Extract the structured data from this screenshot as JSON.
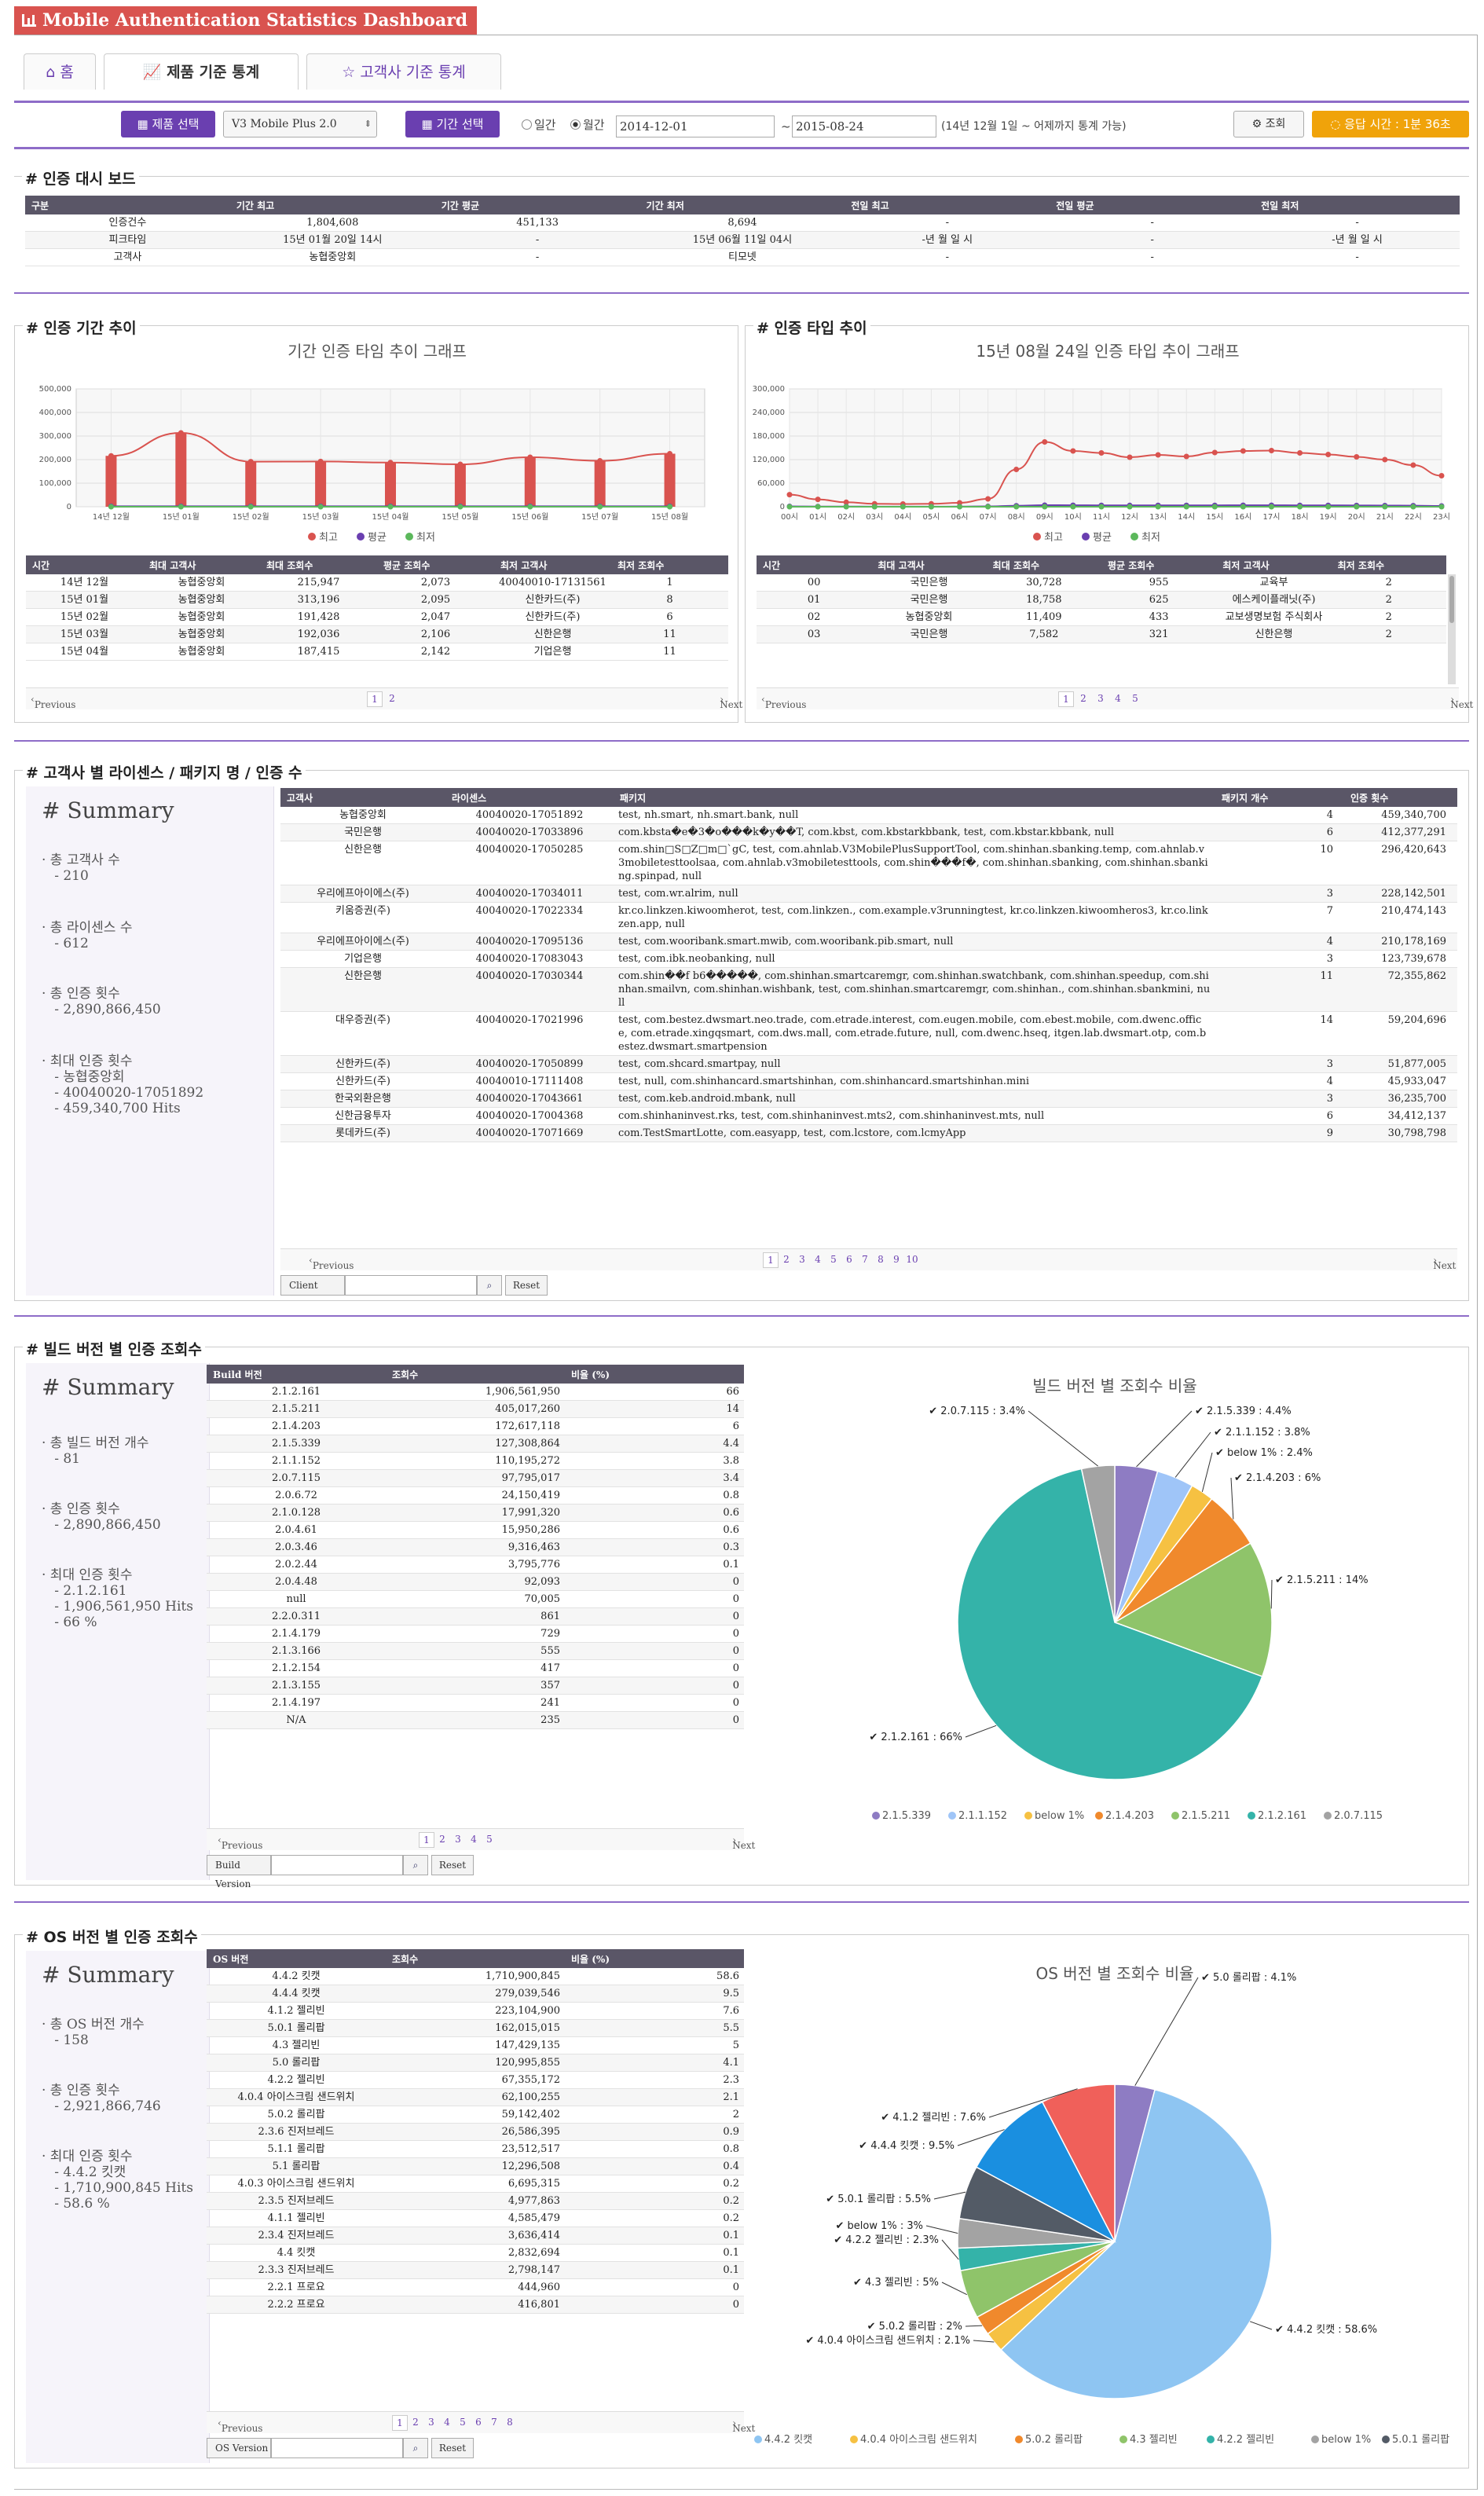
{
  "app": {
    "title": "Mobile Authentication Statistics Dashboard"
  },
  "tabs": [
    {
      "label": "홈",
      "icon": "home-icon"
    },
    {
      "label": "제품 기준 통계",
      "icon": "chart-icon"
    },
    {
      "label": "고객사 기준 통계",
      "icon": "star-icon"
    }
  ],
  "toolbar": {
    "product_btn": "제품 선택",
    "product_value": "V3 Mobile Plus 2.0",
    "period_btn": "기간 선택",
    "radio_daily": "일간",
    "radio_monthly": "월간",
    "selected": "월간",
    "from": "2014-12-01",
    "tilde": "~",
    "to": "2015-08-24",
    "note": "(14년 12월 1일 ~ 어제까지 통계 가능)",
    "query_btn": "조회",
    "response": "응답 시간 : 1분 36초"
  },
  "dashboard": {
    "title": "# 인증 대시 보드",
    "headers": [
      "구분",
      "기간 최고",
      "기간 평균",
      "기간 최저",
      "전일 최고",
      "전일 평균",
      "전일 최저"
    ],
    "rows": [
      [
        "인증건수",
        "1,804,608",
        "451,133",
        "8,694",
        "-",
        "-",
        "-"
      ],
      [
        "피크타임",
        "15년 01월 20일 14시",
        "-",
        "15년 06월 11일 04시",
        "-년 월 일 시",
        "-",
        "-년 월 일 시"
      ],
      [
        "고객사",
        "농협중앙회",
        "-",
        "티모넷",
        "-",
        "-",
        "-"
      ]
    ]
  },
  "period_trend": {
    "title": "# 인증 기간 추이",
    "chart_title": "기간 인증 타임 추이 그래프",
    "headers": [
      "시간",
      "최대 고객사",
      "최대 조회수",
      "평균 조회수",
      "최저 고객사",
      "최저 조회수"
    ],
    "rows": [
      [
        "14년 12월",
        "농협중앙회",
        "215,947",
        "2,073",
        "40040010-17131561",
        "1"
      ],
      [
        "15년 01월",
        "농협중앙회",
        "313,196",
        "2,095",
        "신한카드(주)",
        "8"
      ],
      [
        "15년 02월",
        "농협중앙회",
        "191,428",
        "2,047",
        "신한카드(주)",
        "6"
      ],
      [
        "15년 03월",
        "농협중앙회",
        "192,036",
        "2,106",
        "신한은행",
        "11"
      ],
      [
        "15년 04월",
        "농협중앙회",
        "187,415",
        "2,142",
        "기업은행",
        "11"
      ]
    ],
    "pager": {
      "prev": "Previous",
      "next": "Next",
      "pages": [
        "1",
        "2"
      ]
    }
  },
  "type_trend": {
    "title": "# 인증 타입 추이",
    "chart_title": "15년 08월 24일 인증 타입 추이 그래프",
    "headers": [
      "시간",
      "최대 고객사",
      "최대 조회수",
      "평균 조회수",
      "최저 고객사",
      "최저 조회수"
    ],
    "rows": [
      [
        "00",
        "국민은행",
        "30,728",
        "955",
        "교육부",
        "2"
      ],
      [
        "01",
        "국민은행",
        "18,758",
        "625",
        "에스케이플래닛(주)",
        "2"
      ],
      [
        "02",
        "농협중앙회",
        "11,409",
        "433",
        "교보생명보험 주식회사",
        "2"
      ],
      [
        "03",
        "국민은행",
        "7,582",
        "321",
        "신한은행",
        "2"
      ]
    ],
    "pager": {
      "prev": "Previous",
      "next": "Next",
      "pages": [
        "1",
        "2",
        "3",
        "4",
        "5"
      ]
    }
  },
  "client_section": {
    "title": "# 고객사 별 라이센스 / 패키지 명 / 인증 수",
    "summary": {
      "heading": "# Summary",
      "items": [
        "· 총 고객사 수\n   - 210",
        "· 총 라이센스 수\n   - 612",
        "· 총 인증 횟수\n   - 2,890,866,450",
        "· 최대 인증 횟수\n   - 농협중앙회\n   - 40040020-17051892\n   - 459,340,700 Hits"
      ]
    },
    "headers": [
      "고객사",
      "라이센스",
      "패키지",
      "패키지 개수",
      "인증 횟수"
    ],
    "rows": [
      [
        "농협중앙회",
        "40040020-17051892",
        "test, nh.smart, nh.smart.bank, null",
        "4",
        "459,340,700"
      ],
      [
        "국민은행",
        "40040020-17033896",
        "com.kbsta�e�3�o���k�y��T, com.kbst, com.kbstarkbbank, test, com.kbstar.kbbank, null",
        "6",
        "412,377,291"
      ],
      [
        "신한은행",
        "40040020-17050285",
        "com.shin□S□Z□m□`gC, test, com.ahnlab.V3MobilePlusSupportTool, com.shinhan.sbanking.temp, com.ahnlab.v3mobiletesttoolsaa, com.ahnlab.v3mobiletesttools, com.shin���f�, com.shinhan.sbanking, com.shinhan.sbanking.spinpad, null",
        "10",
        "296,420,643"
      ],
      [
        "우리에프아이에스(주)",
        "40040020-17034011",
        "test, com.wr.alrim, null",
        "3",
        "228,142,501"
      ],
      [
        "키움증권(주)",
        "40040020-17022334",
        "kr.co.linkzen.kiwoomherot, test, com.linkzen., com.example.v3runningtest, kr.co.linkzen.kiwoomheros3, kr.co.linkzen.app, null",
        "7",
        "210,474,143"
      ],
      [
        "우리에프아이에스(주)",
        "40040020-17095136",
        "test, com.wooribank.smart.mwib, com.wooribank.pib.smart, null",
        "4",
        "210,178,169"
      ],
      [
        "기업은행",
        "40040020-17083043",
        "test, com.ibk.neobanking, null",
        "3",
        "123,739,678"
      ],
      [
        "신한은행",
        "40040020-17030344",
        "com.shin��f b6�����, com.shinhan.smartcaremgr, com.shinhan.swatchbank, com.shinhan.speedup, com.shinhan.smailvn, com.shinhan.wishbank, test, com.shinhan.smartcaremgr, com.shinhan., com.shinhan.sbankmini, null",
        "11",
        "72,355,862"
      ],
      [
        "대우증권(주)",
        "40040020-17021996",
        "test, com.bestez.dwsmart.neo.trade, com.etrade.interest, com.eugen.mobile, com.ebest.mobile, com.dwenc.office, com.etrade.xingqsmart, com.dws.mall, com.etrade.future, null, com.dwenc.hseq, itgen.lab.dwsmart.otp, com.bestez.dwsmart.smartpension",
        "14",
        "59,204,696"
      ],
      [
        "신한카드(주)",
        "40040020-17050899",
        "test, com.shcard.smartpay, null",
        "3",
        "51,877,005"
      ],
      [
        "신한카드(주)",
        "40040010-17111408",
        "test, null, com.shinhancard.smartshinhan, com.shinhancard.smartshinhan.mini",
        "4",
        "45,933,047"
      ],
      [
        "한국외환은행",
        "40040020-17043661",
        "test, com.keb.android.mbank, null",
        "3",
        "36,235,700"
      ],
      [
        "신한금융투자",
        "40040020-17004368",
        "com.shinhaninvest.rks, test, com.shinhaninvest.mts2, com.shinhaninvest.mts, null",
        "6",
        "34,412,137"
      ],
      [
        "롯데카드(주)",
        "40040020-17071669",
        "com.TestSmartLotte, com.easyapp, test, com.lcstore, com.lcmyApp",
        "9",
        "30,798,798"
      ]
    ],
    "pager": {
      "prev": "Previous",
      "next": "Next",
      "pages": [
        "1",
        "2",
        "3",
        "4",
        "5",
        "6",
        "7",
        "8",
        "9",
        "10"
      ]
    },
    "search": {
      "label": "Client",
      "reset": "Reset"
    }
  },
  "build_section": {
    "title": "# 빌드 버전 별 인증 조회수",
    "summary": {
      "heading": "# Summary",
      "items": [
        "· 총 빌드 버전 개수\n   - 81",
        "· 총 인증 횟수\n   - 2,890,866,450",
        "· 최대 인증 횟수\n   - 2.1.2.161\n   - 1,906,561,950 Hits\n   - 66 %"
      ]
    },
    "headers": [
      "Build 버전",
      "조회수",
      "비율 (%)"
    ],
    "rows": [
      [
        "2.1.2.161",
        "1,906,561,950",
        "66"
      ],
      [
        "2.1.5.211",
        "405,017,260",
        "14"
      ],
      [
        "2.1.4.203",
        "172,617,118",
        "6"
      ],
      [
        "2.1.5.339",
        "127,308,864",
        "4.4"
      ],
      [
        "2.1.1.152",
        "110,195,272",
        "3.8"
      ],
      [
        "2.0.7.115",
        "97,795,017",
        "3.4"
      ],
      [
        "2.0.6.72",
        "24,150,419",
        "0.8"
      ],
      [
        "2.1.0.128",
        "17,991,320",
        "0.6"
      ],
      [
        "2.0.4.61",
        "15,950,286",
        "0.6"
      ],
      [
        "2.0.3.46",
        "9,316,463",
        "0.3"
      ],
      [
        "2.0.2.44",
        "3,795,776",
        "0.1"
      ],
      [
        "2.0.4.48",
        "92,093",
        "0"
      ],
      [
        "null",
        "70,005",
        "0"
      ],
      [
        "2.2.0.311",
        "861",
        "0"
      ],
      [
        "2.1.4.179",
        "729",
        "0"
      ],
      [
        "2.1.3.166",
        "555",
        "0"
      ],
      [
        "2.1.2.154",
        "417",
        "0"
      ],
      [
        "2.1.3.155",
        "357",
        "0"
      ],
      [
        "2.1.4.197",
        "241",
        "0"
      ],
      [
        "N/A",
        "235",
        "0"
      ]
    ],
    "pager": {
      "prev": "Previous",
      "next": "Next",
      "pages": [
        "1",
        "2",
        "3",
        "4",
        "5"
      ]
    },
    "search": {
      "label": "Build Version",
      "reset": "Reset"
    }
  },
  "os_section": {
    "title": "# OS 버전 별 인증 조회수",
    "summary": {
      "heading": "# Summary",
      "items": [
        "· 총 OS 버전 개수\n   - 158",
        "· 총 인증 횟수\n   - 2,921,866,746",
        "· 최대 인증 횟수\n   - 4.4.2 킷캣\n   - 1,710,900,845 Hits\n   - 58.6 %"
      ]
    },
    "headers": [
      "OS 버전",
      "조회수",
      "비율 (%)"
    ],
    "rows": [
      [
        "4.4.2 킷캣",
        "1,710,900,845",
        "58.6"
      ],
      [
        "4.4.4 킷캣",
        "279,039,546",
        "9.5"
      ],
      [
        "4.1.2 젤리빈",
        "223,104,900",
        "7.6"
      ],
      [
        "5.0.1 롤리팝",
        "162,015,015",
        "5.5"
      ],
      [
        "4.3 젤리빈",
        "147,429,135",
        "5"
      ],
      [
        "5.0 롤리팝",
        "120,995,855",
        "4.1"
      ],
      [
        "4.2.2 젤리빈",
        "67,355,172",
        "2.3"
      ],
      [
        "4.0.4 아이스크림 샌드위치",
        "62,100,255",
        "2.1"
      ],
      [
        "5.0.2 롤리팝",
        "59,142,402",
        "2"
      ],
      [
        "2.3.6 진저브레드",
        "26,586,395",
        "0.9"
      ],
      [
        "5.1.1 롤리팝",
        "23,512,517",
        "0.8"
      ],
      [
        "5.1 롤리팝",
        "12,296,508",
        "0.4"
      ],
      [
        "4.0.3 아이스크림 샌드위치",
        "6,695,315",
        "0.2"
      ],
      [
        "2.3.5 진저브레드",
        "4,977,863",
        "0.2"
      ],
      [
        "4.1.1 젤리빈",
        "4,585,479",
        "0.2"
      ],
      [
        "2.3.4 진저브레드",
        "3,636,414",
        "0.1"
      ],
      [
        "4.4 킷캣",
        "2,832,694",
        "0.1"
      ],
      [
        "2.3.3 진저브레드",
        "2,798,147",
        "0.1"
      ],
      [
        "2.2.1 프로요",
        "444,960",
        "0"
      ],
      [
        "2.2.2 프로요",
        "416,801",
        "0"
      ]
    ],
    "pager": {
      "prev": "Previous",
      "next": "Next",
      "pages": [
        "1",
        "2",
        "3",
        "4",
        "5",
        "6",
        "7",
        "8"
      ]
    },
    "search": {
      "label": "OS Version",
      "reset": "Reset"
    }
  },
  "chart_data": [
    {
      "type": "line",
      "title": "기간 인증 타임 추이 그래프",
      "categories": [
        "14년 12월",
        "15년 01월",
        "15년 02월",
        "15년 03월",
        "15년 04월",
        "15년 05월",
        "15년 06월",
        "15년 07월",
        "15년 08월"
      ],
      "series": [
        {
          "name": "최고",
          "color": "#d9534f",
          "values": [
            215947,
            313196,
            191428,
            192036,
            187415,
            180000,
            210000,
            195000,
            225000
          ]
        },
        {
          "name": "평균",
          "color": "#6a3fb0",
          "values": [
            2073,
            2095,
            2047,
            2106,
            2142,
            2100,
            2100,
            2100,
            2100
          ]
        },
        {
          "name": "최저",
          "color": "#5cb85c",
          "values": [
            1,
            8,
            6,
            11,
            11,
            5,
            5,
            5,
            5
          ]
        }
      ],
      "bars": [
        215947,
        313196,
        191428,
        192036,
        187415,
        180000,
        210000,
        195000,
        225000
      ],
      "ylim": [
        0,
        500000
      ],
      "yticks": [
        "0",
        "100,000",
        "200,000",
        "300,000",
        "400,000",
        "500,000"
      ],
      "grid": true,
      "legend": "bottom"
    },
    {
      "type": "line",
      "title": "15년 08월 24일 인증 타입 추이 그래프",
      "categories": [
        "00시",
        "01시",
        "02시",
        "03시",
        "04시",
        "05시",
        "06시",
        "07시",
        "08시",
        "09시",
        "10시",
        "11시",
        "12시",
        "13시",
        "14시",
        "15시",
        "16시",
        "17시",
        "18시",
        "19시",
        "20시",
        "21시",
        "22시",
        "23시"
      ],
      "series": [
        {
          "name": "최고",
          "color": "#d9534f",
          "values": [
            30728,
            18758,
            11409,
            7582,
            7000,
            7500,
            10000,
            20000,
            95000,
            165000,
            142000,
            137000,
            126000,
            132000,
            128000,
            138000,
            142000,
            143000,
            137000,
            133000,
            127000,
            120000,
            106000,
            79000
          ]
        },
        {
          "name": "평균",
          "color": "#6a3fb0",
          "values": [
            955,
            625,
            433,
            321,
            300,
            300,
            400,
            900,
            2500,
            4000,
            3800,
            3600,
            3400,
            3500,
            3500,
            3600,
            3700,
            3700,
            3600,
            3500,
            3300,
            3100,
            2700,
            2000
          ]
        },
        {
          "name": "최저",
          "color": "#5cb85c",
          "values": [
            2,
            2,
            2,
            2,
            2,
            2,
            2,
            2,
            2,
            2,
            2,
            2,
            2,
            2,
            2,
            2,
            2,
            2,
            2,
            2,
            2,
            2,
            2,
            2
          ]
        }
      ],
      "ylim": [
        0,
        300000
      ],
      "yticks": [
        "0",
        "60,000",
        "120,000",
        "180,000",
        "240,000",
        "300,000"
      ],
      "grid": true,
      "legend": "bottom"
    },
    {
      "type": "pie",
      "title": "빌드 버전 별 조회수 비율",
      "categories": [
        "2.1.5.339",
        "2.1.1.152",
        "below 1%",
        "2.1.4.203",
        "2.1.5.211",
        "2.1.2.161",
        "2.0.7.115"
      ],
      "values": [
        4.4,
        3.8,
        2.4,
        6,
        14,
        66,
        3.4
      ],
      "labels": [
        "2.1.5.339 : 4.4%",
        "2.1.1.152 : 3.8%",
        "below 1% : 2.4%",
        "2.1.4.203 : 6%",
        "2.1.5.211 : 14%",
        "2.1.2.161 : 66%",
        "2.0.7.115 : 3.4%"
      ],
      "colors": [
        "#8e7cc3",
        "#9fc5f8",
        "#f6c142",
        "#f0892c",
        "#8fc46a",
        "#34b3a9",
        "#a3a3a3"
      ],
      "legend": "bottom"
    },
    {
      "type": "pie",
      "title": "OS 버전 별 조회수 비율",
      "categories": [
        "5.0 롤리팝",
        "4.4.2 킷캣",
        "4.0.4 아이스크림 샌드위치",
        "5.0.2 롤리팝",
        "4.3 젤리빈",
        "4.2.2 젤리빈",
        "below 1%",
        "5.0.1 롤리팝",
        "4.4.4 킷캣",
        "4.1.2 젤리빈"
      ],
      "values": [
        4.1,
        58.6,
        2.1,
        2,
        5,
        2.3,
        3,
        5.5,
        9.5,
        7.6
      ],
      "labels": [
        "5.0 롤리팝 : 4.1%",
        "4.4.2 킷캣 : 58.6%",
        "4.0.4 아이스크림 샌드위치 : 2.1%",
        "5.0.2 롤리팝 : 2%",
        "4.3 젤리빈 : 5%",
        "4.2.2 젤리빈 : 2.3%",
        "below 1% : 3%",
        "5.0.1 롤리팝 : 5.5%",
        "4.4.4 킷캣 : 9.5%",
        "4.1.2 젤리빈 : 7.6%"
      ],
      "colors": [
        "#8e7cc3",
        "#8ec5f2",
        "#f6c142",
        "#f0892c",
        "#8fc46a",
        "#34b3a9",
        "#a3a3a3",
        "#535b66",
        "#1a8fe0",
        "#f0605a"
      ],
      "legend_items": [
        "4.4.2 킷캣",
        "4.0.4 아이스크림 샌드위치",
        "5.0.2 롤리팝",
        "4.3 젤리빈",
        "4.2.2 젤리빈",
        "below 1%",
        "5.0.1 롤리팝",
        "4.4.4 킷캣"
      ],
      "legend": "bottom"
    }
  ]
}
